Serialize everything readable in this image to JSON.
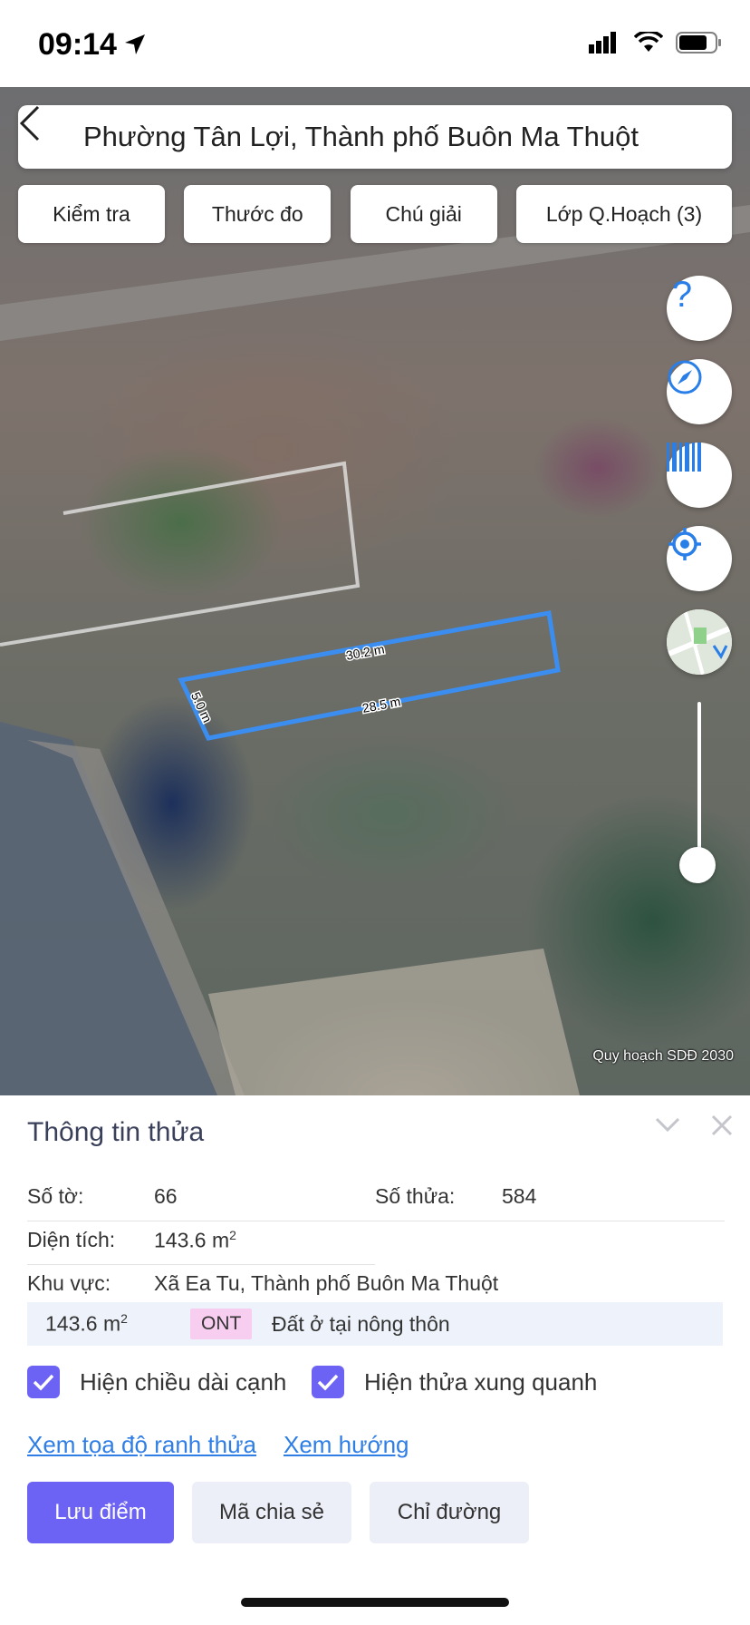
{
  "status_bar": {
    "time": "09:14"
  },
  "search": {
    "title": "Phường Tân Lợi, Thành phố Buôn Ma Thuột"
  },
  "map_tabs": [
    {
      "label": "Kiểm tra"
    },
    {
      "label": "Thước đo"
    },
    {
      "label": "Chú giải"
    },
    {
      "label": "Lớp Q.Hoạch (3)"
    }
  ],
  "map": {
    "edges": {
      "top": "30.2 m",
      "bottom": "28.5 m",
      "left": "5.0 m"
    },
    "watermark": "Quy hoạch SDĐ 2030",
    "controls": [
      "help-icon",
      "compass-icon",
      "barcode-icon",
      "locate-icon",
      "map-thumbnail-icon"
    ],
    "parcel_color": "#3b8df0",
    "zoom_level": 0.9
  },
  "panel": {
    "title": "Thông tin thửa",
    "so_to": {
      "label": "Số tờ:",
      "value": "66"
    },
    "so_thua": {
      "label": "Số thửa:",
      "value": "584"
    },
    "dien_tich": {
      "label": "Diện tích:",
      "value": "143.6 m",
      "unit_sup": "2"
    },
    "khu_vuc": {
      "label": "Khu vực:",
      "value": "Xã Ea Tu, Thành phố Buôn Ma Thuột"
    },
    "land_use": {
      "area": "143.6 m",
      "area_sup": "2",
      "code": "ONT",
      "description": "Đất ở tại nông thôn"
    },
    "checkboxes": [
      {
        "label": "Hiện chiều dài cạnh",
        "checked": true
      },
      {
        "label": "Hiện thửa xung quanh",
        "checked": true
      }
    ],
    "links": {
      "coords": "Xem tọa độ ranh thửa",
      "direction": "Xem hướng"
    },
    "buttons": {
      "save": "Lưu điểm",
      "share": "Mã chia sẻ",
      "route": "Chỉ đường"
    },
    "accent_color": "#6c63f5"
  }
}
